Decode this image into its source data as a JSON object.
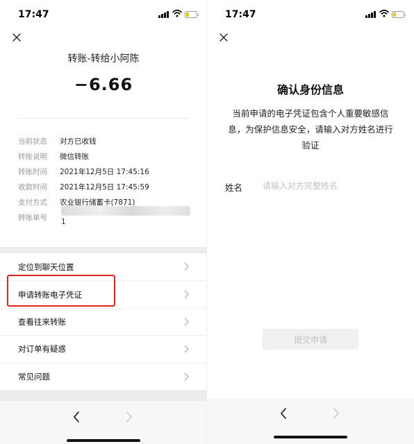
{
  "status_bar": {
    "time": "17:47"
  },
  "left": {
    "title": "转账-转给小阿陈",
    "amount": "−6.66",
    "details": [
      {
        "key": "当前状态",
        "value": "对方已收钱"
      },
      {
        "key": "转账说明",
        "value": "微信转账"
      },
      {
        "key": "转账时间",
        "value": "2021年12月5日 17:45:16"
      },
      {
        "key": "收款时间",
        "value": "2021年12月5日 17:45:59"
      },
      {
        "key": "支付方式",
        "value": "农业银行储蓄卡(7871)"
      },
      {
        "key": "转账单号",
        "value": ""
      }
    ],
    "order_tail": "1",
    "menu": [
      "定位到聊天位置",
      "申请转账电子凭证",
      "查看往来转账",
      "对订单有疑惑",
      "常见问题"
    ],
    "highlight_color": "#e2231a"
  },
  "right": {
    "title": "确认身份信息",
    "description": "当前申请的电子凭证包含个人重要敏感信息，为保护信息安全，请输入对方姓名进行验证",
    "name_label": "姓名",
    "name_placeholder": "请输入对方完整姓名",
    "name_value": "",
    "submit_label": "提交申请"
  },
  "icons": {
    "close": "close-icon",
    "back": "chevron-left-icon",
    "forward": "chevron-right-icon",
    "signal": "cellular-signal-icon",
    "wifi": "wifi-icon",
    "battery": "battery-icon"
  }
}
